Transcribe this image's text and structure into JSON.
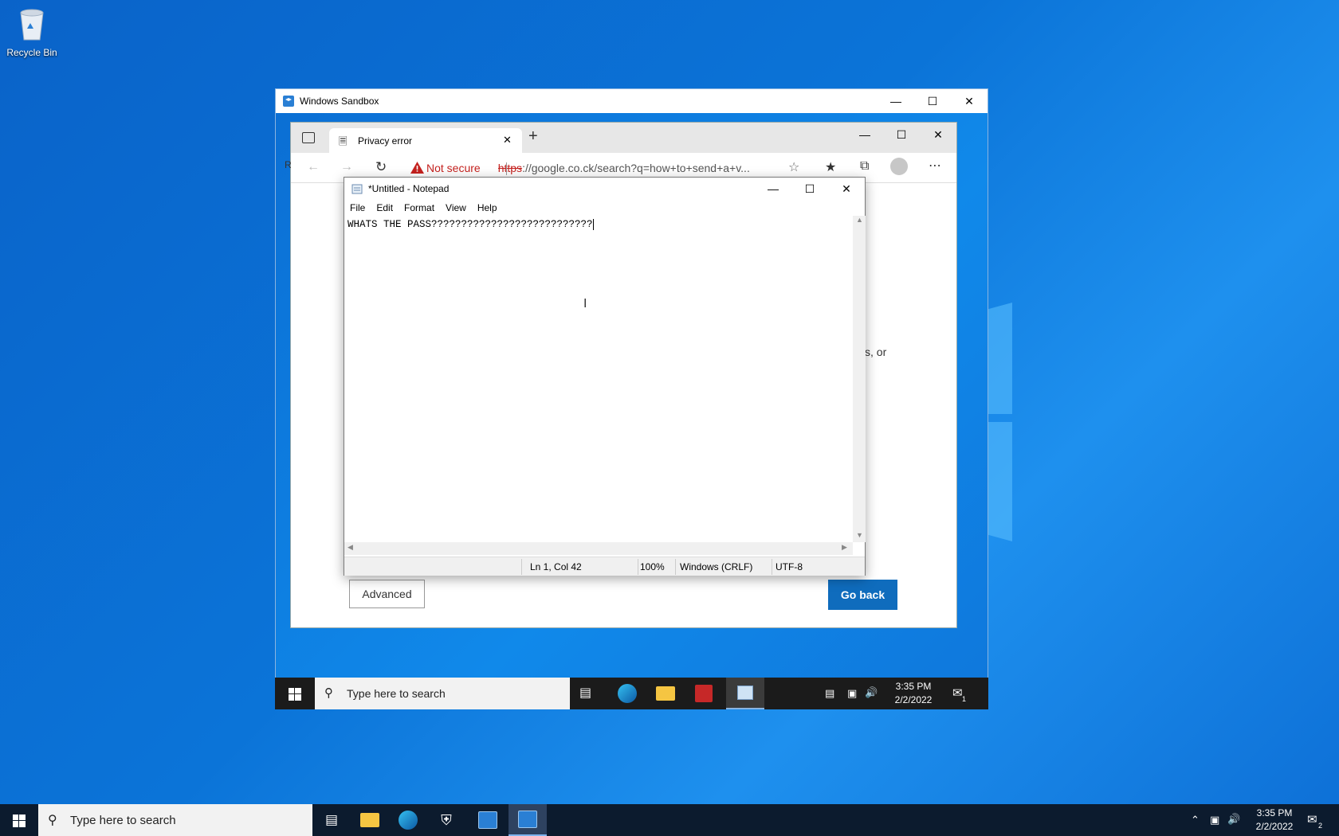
{
  "desktop": {
    "recycle_bin_label": "Recycle Bin"
  },
  "sandbox": {
    "title": "Windows Sandbox"
  },
  "edge": {
    "tab_title": "Privacy error",
    "not_secure_label": "Not secure",
    "url_scheme": "https",
    "url_rest": "://google.co.ck/search?q=how+to+send+a+v...",
    "page_fragment_r": "R",
    "page_fragment_text": "s, or",
    "advanced_label": "Advanced",
    "go_back_label": "Go back"
  },
  "notepad": {
    "title": "*Untitled - Notepad",
    "menu": [
      "File",
      "Edit",
      "Format",
      "View",
      "Help"
    ],
    "content": "WHATS THE PASS???????????????????????????",
    "status": {
      "position": "Ln 1, Col 42",
      "zoom": "100%",
      "line_endings": "Windows (CRLF)",
      "encoding": "UTF-8"
    }
  },
  "sandbox_taskbar": {
    "search_placeholder": "Type here to search",
    "time": "3:35 PM",
    "date": "2/2/2022",
    "notification_count": "1"
  },
  "taskbar": {
    "search_placeholder": "Type here to search",
    "time": "3:35 PM",
    "date": "2/2/2022",
    "notification_count": "2"
  },
  "colors": {
    "accent": "#0f6cbd",
    "warning": "#c5221f",
    "taskbar": "#0c1b2e"
  }
}
